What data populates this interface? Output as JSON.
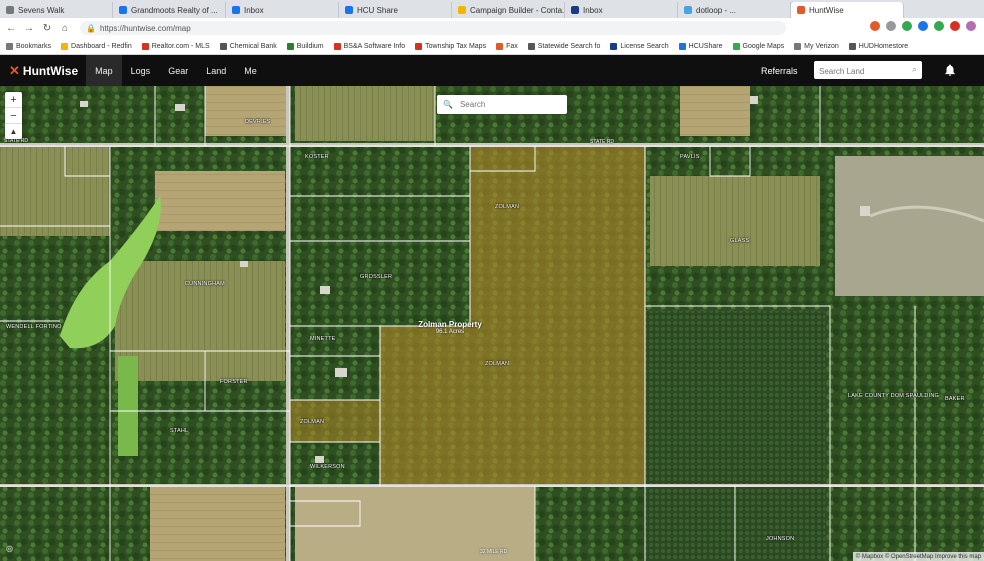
{
  "browser": {
    "tabs": [
      {
        "label": "Sevens Walk",
        "color": "#777777"
      },
      {
        "label": "Grandmoots Realty of ...",
        "color": "#1a73e8"
      },
      {
        "label": "Inbox",
        "color": "#1a73e8"
      },
      {
        "label": "HCU Share",
        "color": "#1a73e8"
      },
      {
        "label": "Campaign Builder - Conta...",
        "color": "#f4b400"
      },
      {
        "label": "Inbox",
        "color": "#1a3a8a"
      },
      {
        "label": "dotloop - ...",
        "color": "#4aa3df"
      },
      {
        "label": "HuntWise",
        "color": "#e25a2a"
      }
    ],
    "url": "https://huntwise.com/map",
    "bookmarks": [
      {
        "label": "Bookmarks",
        "color": "#777777"
      },
      {
        "label": "Dashboard - Redfin",
        "color": "#f4b400"
      },
      {
        "label": "Realtor.com - MLS",
        "color": "#d93025"
      },
      {
        "label": "Chemical Bank",
        "color": "#555555"
      },
      {
        "label": "Buildium",
        "color": "#2e7d32"
      },
      {
        "label": "BS&A Software Info",
        "color": "#d93025"
      },
      {
        "label": "Township Tax Maps",
        "color": "#d93025"
      },
      {
        "label": "Fax",
        "color": "#e25a2a"
      },
      {
        "label": "Statewide Search fo",
        "color": "#555555"
      },
      {
        "label": "License Search",
        "color": "#1a3a8a"
      },
      {
        "label": "HCUShare",
        "color": "#1a73e8"
      },
      {
        "label": "Google Maps",
        "color": "#34a853"
      },
      {
        "label": "My Verizon",
        "color": "#777777"
      },
      {
        "label": "HUDHomestore",
        "color": "#555555"
      }
    ]
  },
  "app": {
    "logo": "HuntWise",
    "nav": [
      {
        "label": "Map",
        "active": true
      },
      {
        "label": "Logs",
        "active": false
      },
      {
        "label": "Gear",
        "active": false
      },
      {
        "label": "Land",
        "active": false
      },
      {
        "label": "Me",
        "active": false
      }
    ],
    "referrals": "Referrals",
    "search_placeholder": "Search Land"
  },
  "map": {
    "search_placeholder": "Search",
    "controls": {
      "zoom_in": "+",
      "zoom_out": "−",
      "north": "▲"
    },
    "property": {
      "title": "Zolman Property",
      "acres": "96.1 Acres"
    },
    "attribution": "© Mapbox © OpenStreetMap Improve this map",
    "parcel_labels": [
      "WENDELL FORTINO",
      "CUNNINGHAM",
      "GROSSLER",
      "ZOLMAN",
      "GLASS",
      "LAKE COUNTY DOM SPAULDING",
      "JOHNSON",
      "FORSTER",
      "STAHL",
      "WILKERSON",
      "DEVRIES",
      "KOSTER",
      "PAVLIS",
      "MINETTE",
      "BAKER"
    ],
    "road_labels": [
      "STATE RD",
      "STATE RD",
      "32 MILE RD"
    ]
  }
}
